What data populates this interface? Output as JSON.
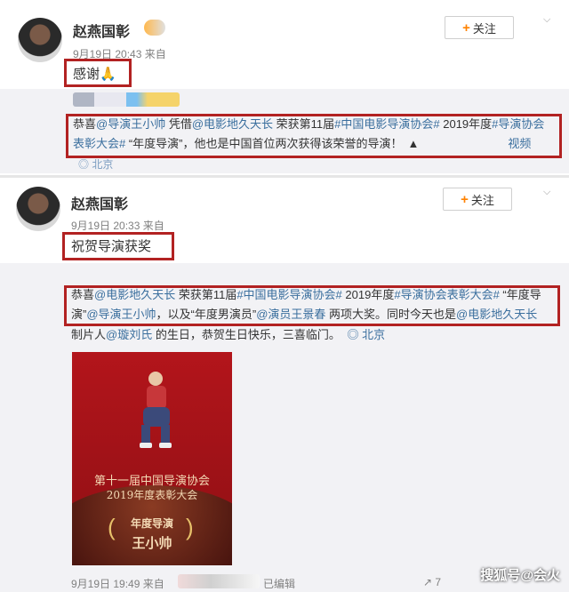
{
  "post1": {
    "author": "赵燕国彰",
    "time": "9月19日 20:43 来自",
    "follow_label": "关注",
    "text": "感谢🙏",
    "repost": {
      "line1_parts": [
        "恭喜",
        "@导演王小帅",
        " 凭借",
        "@电影地久天长",
        " 荣获第11届",
        "#中国电影导演协会#",
        " 2019年度",
        "#导演协会"
      ],
      "line2_parts": [
        "表彰大会#",
        " “年度导演”，他也是中国首位两次获得该荣誉的导演！",
        "视频"
      ],
      "location": "北京"
    }
  },
  "post2": {
    "author": "赵燕国彰",
    "time": "9月19日 20:33 来自",
    "follow_label": "关注",
    "text": "祝贺导演获奖",
    "repost": {
      "line1_parts": [
        "恭喜",
        "@电影地久天长",
        " 荣获第11届",
        "#中国电影导演协会#",
        " 2019年度",
        "#导演协会表彰大会#",
        " “年度导"
      ],
      "line2_parts": [
        "演”",
        "@导演王小帅",
        "，以及“年度男演员”",
        "@演员王景春",
        " 两项大奖。同时今天也是",
        "@电影地久天长"
      ],
      "line3_parts": [
        "制片人",
        "@璇刘氏",
        " 的生日，恭贺生日快乐，三喜临门。"
      ],
      "location": "北京",
      "poster": {
        "line1": "第十一届中国导演协会",
        "line2": "2019年度表彰大会",
        "award": "年度导演",
        "person": "王小帅"
      },
      "footer_time": "9月19日 19:49 来自",
      "edited": "已编辑",
      "repost_count": "7"
    }
  },
  "watermark": "搜狐号@会火",
  "colors": {
    "accent": "#ff8200",
    "link": "#3b6f9e",
    "highlight": "#b22222"
  },
  "icons": {
    "chevron": "chevron-down-icon",
    "location": "location-pin-icon",
    "share": "share-icon"
  }
}
